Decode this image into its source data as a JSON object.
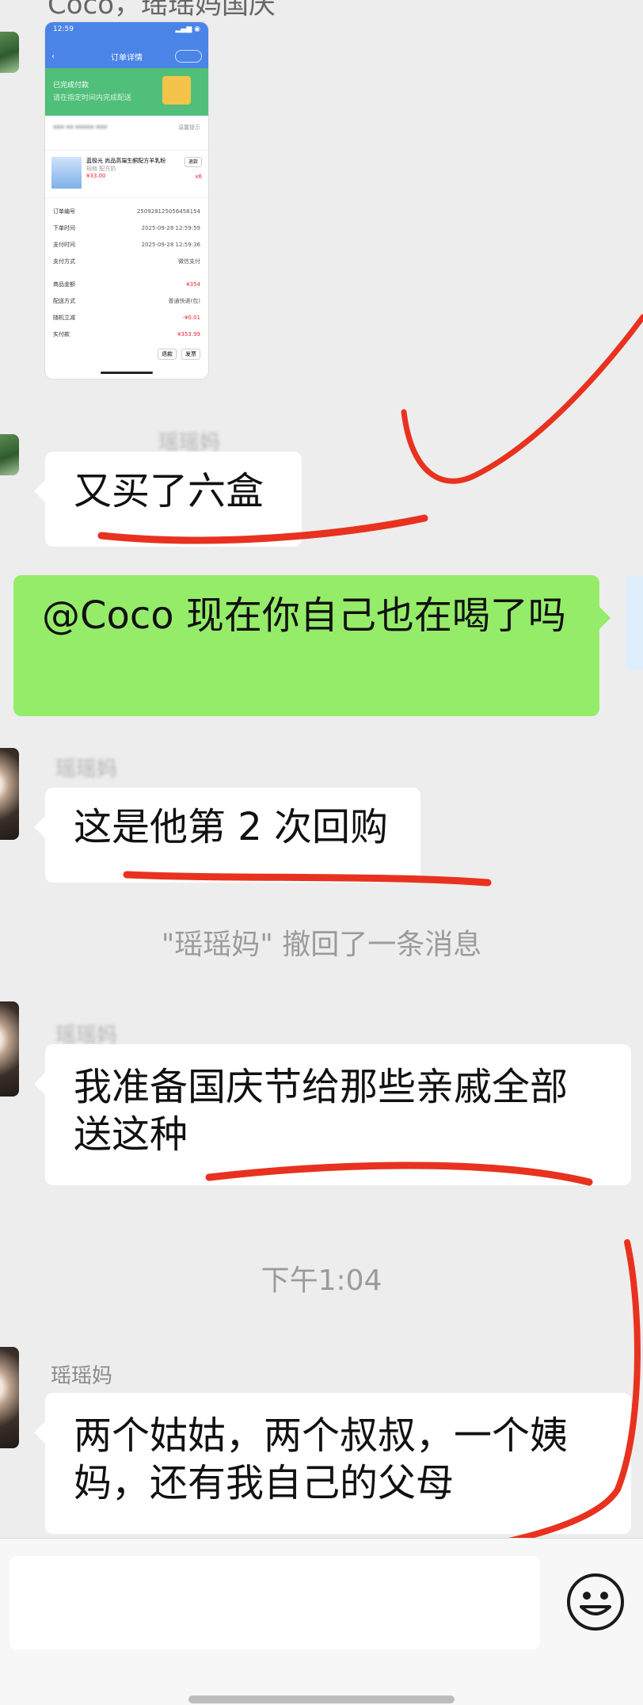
{
  "top_partial_text": "Coco，瑶瑶妈国庆",
  "order_screenshot": {
    "time": "12:59",
    "page_title": "订单详情",
    "status": "已完成付款",
    "status_sub": "请在指定时间内完成配送",
    "address_hint": "温馨提示",
    "product_name": "蓝极光 尚品高端生酮配方羊乳粉",
    "product_spec": "规格 配方奶",
    "product_price": "¥33.00",
    "product_qty": "x6",
    "refund_btn": "退款",
    "rows": [
      {
        "label": "订单编号",
        "value": "250928125056458154"
      },
      {
        "label": "下单时间",
        "value": "2025-09-28 12:59:59"
      },
      {
        "label": "支付时间",
        "value": "2025-09-28 12:59:36"
      },
      {
        "label": "支付方式",
        "value": "微信支付"
      },
      {
        "label": "商品金额",
        "value": "¥354"
      },
      {
        "label": "配送方式",
        "value": "普通快递(包)"
      },
      {
        "label": "随机立减",
        "value": "-¥0.01"
      },
      {
        "label": "实付款",
        "value": "¥353.99"
      }
    ],
    "btn_a": "退款",
    "btn_b": "发票"
  },
  "messages": [
    {
      "id": "m1",
      "sender": "瑶瑶妈",
      "text": "又买了六盒"
    },
    {
      "id": "m2",
      "sender": "me",
      "text": "@Coco  现在你自己也在喝了吗"
    },
    {
      "id": "m3",
      "sender": "瑶瑶妈",
      "text": "这是他第 2 次回购"
    },
    {
      "id": "m4",
      "sender": "瑶瑶妈",
      "text": "我准备国庆节给那些亲戚全部送这种"
    },
    {
      "id": "m5",
      "sender": "瑶瑶妈",
      "text": "两个姑姑，两个叔叔，一个姨妈，还有我自己的父母"
    }
  ],
  "recall_notice": "\"瑶瑶妈\" 撤回了一条消息",
  "timestamp": "下午1:04",
  "sender_label": "瑶瑶妈",
  "input": {
    "value": "",
    "emoji_icon": "smiley-icon"
  },
  "colors": {
    "background": "#ededed",
    "own_bubble": "#95ec69",
    "other_bubble": "#ffffff",
    "annotation": "#e8321f"
  }
}
